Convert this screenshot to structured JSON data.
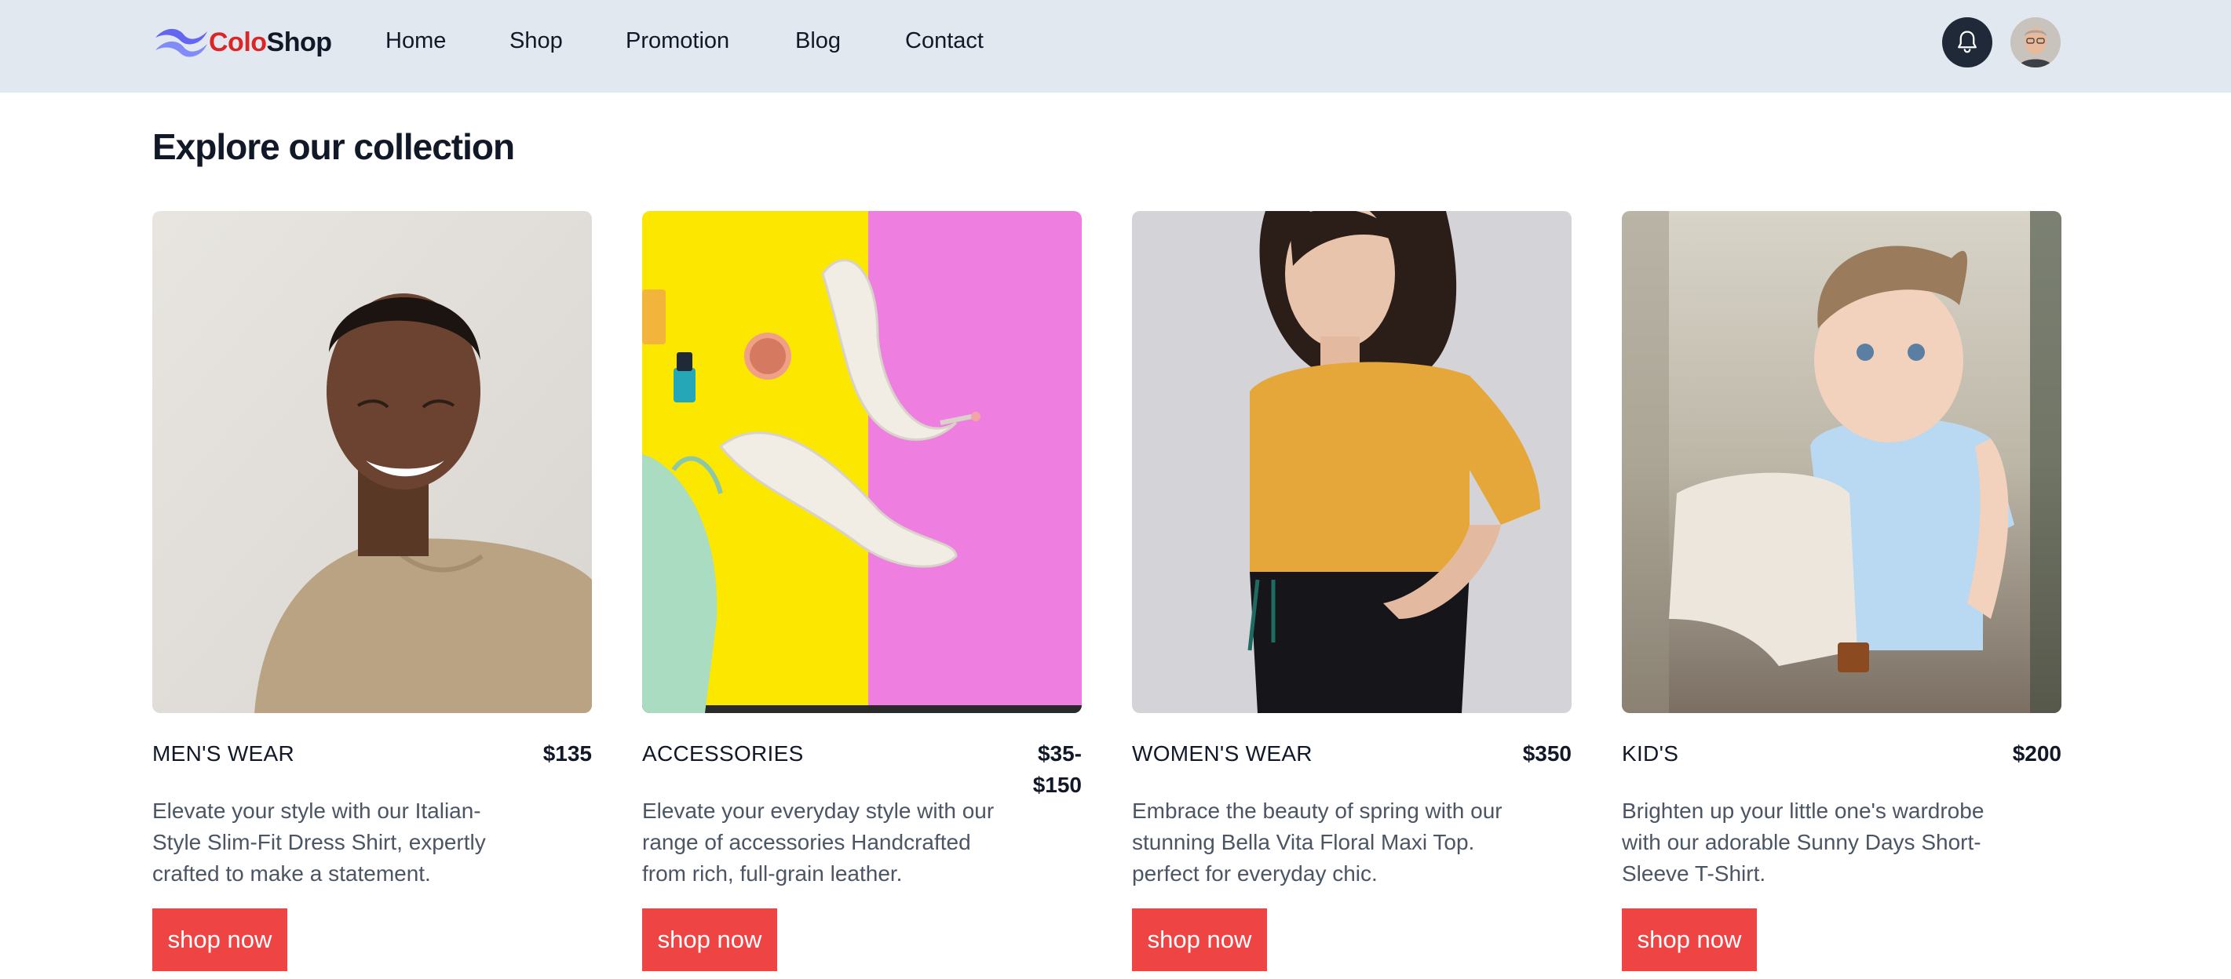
{
  "header": {
    "brand_part1": "Colo",
    "brand_part2": "Shop",
    "nav": [
      "Home",
      "Shop",
      "Promotion",
      "Blog",
      "Contact"
    ]
  },
  "main": {
    "title": "Explore our collection",
    "cards": [
      {
        "category": "MEN'S WEAR",
        "price": "$135",
        "description": "Elevate your style with our Italian-Style Slim-Fit Dress Shirt, expertly crafted to make a statement.",
        "button": "shop now"
      },
      {
        "category": "ACCESSORIES",
        "price": "$35-\n$150",
        "description": "Elevate your everyday style with our range of accessories Handcrafted from rich, full-grain leather.",
        "button": "shop now"
      },
      {
        "category": "WOMEN'S WEAR",
        "price": "$350",
        "description": "Embrace the beauty of spring with our stunning Bella Vita Floral Maxi Top. perfect for everyday chic.",
        "button": "shop now"
      },
      {
        "category": "KID'S",
        "price": "$200",
        "description": "Brighten up your little one's wardrobe with our adorable Sunny Days Short-Sleeve T-Shirt.",
        "button": "shop now"
      }
    ]
  },
  "colors": {
    "header_bg": "#e2e8f0",
    "brand_accent": "#dc2626",
    "logo": "#6366f1",
    "button": "#ef4444",
    "text_muted": "#4b5563"
  },
  "icons": {
    "logo": "wave-logo-icon",
    "notifications": "bell-icon",
    "profile": "user-avatar"
  }
}
